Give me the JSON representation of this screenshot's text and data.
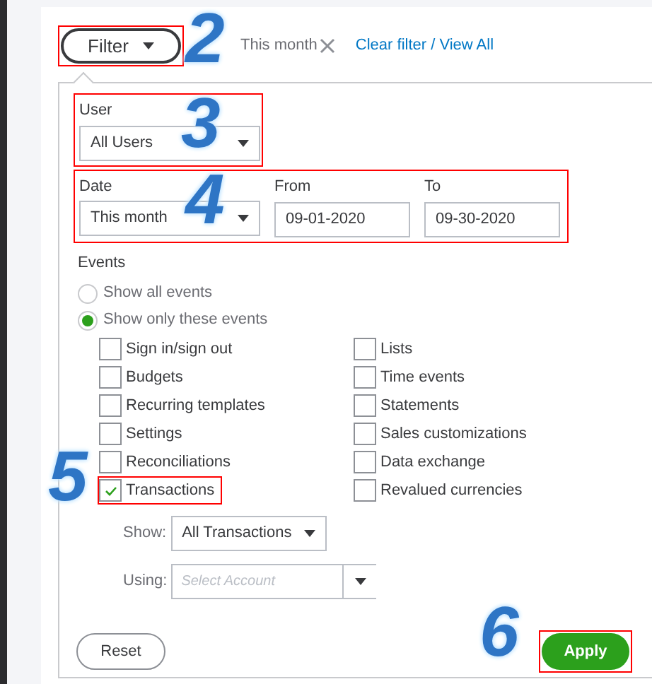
{
  "filter_button": {
    "label": "Filter",
    "highlighted": true
  },
  "active_filter": {
    "label": "This month"
  },
  "clear_link": "Clear filter / View All",
  "user": {
    "label": "User",
    "value": "All Users",
    "highlighted": true
  },
  "date": {
    "label": "Date",
    "value": "This month",
    "from_label": "From",
    "from": "09-01-2020",
    "to_label": "To",
    "to": "09-30-2020",
    "highlighted": true
  },
  "events": {
    "label": "Events",
    "options": [
      {
        "label": "Show all events",
        "selected": false
      },
      {
        "label": "Show only these events",
        "selected": true
      }
    ],
    "columns": [
      [
        {
          "label": "Sign in/sign out",
          "checked": false
        },
        {
          "label": "Budgets",
          "checked": false
        },
        {
          "label": "Recurring templates",
          "checked": false
        },
        {
          "label": "Settings",
          "checked": false
        },
        {
          "label": "Reconciliations",
          "checked": false
        },
        {
          "label": "Transactions",
          "checked": true,
          "highlighted": true
        }
      ],
      [
        {
          "label": "Lists",
          "checked": false
        },
        {
          "label": "Time events",
          "checked": false
        },
        {
          "label": "Statements",
          "checked": false
        },
        {
          "label": "Sales customizations",
          "checked": false
        },
        {
          "label": "Data exchange",
          "checked": false
        },
        {
          "label": "Revalued currencies",
          "checked": false
        }
      ]
    ]
  },
  "show": {
    "label": "Show:",
    "value": "All Transactions"
  },
  "using": {
    "label": "Using:",
    "placeholder": "Select Account"
  },
  "buttons": [
    {
      "label": "Reset",
      "kind": "secondary"
    },
    {
      "label": "Apply",
      "kind": "primary",
      "highlighted": true
    }
  ],
  "callouts": [
    "2",
    "3",
    "4",
    "5",
    "6"
  ]
}
